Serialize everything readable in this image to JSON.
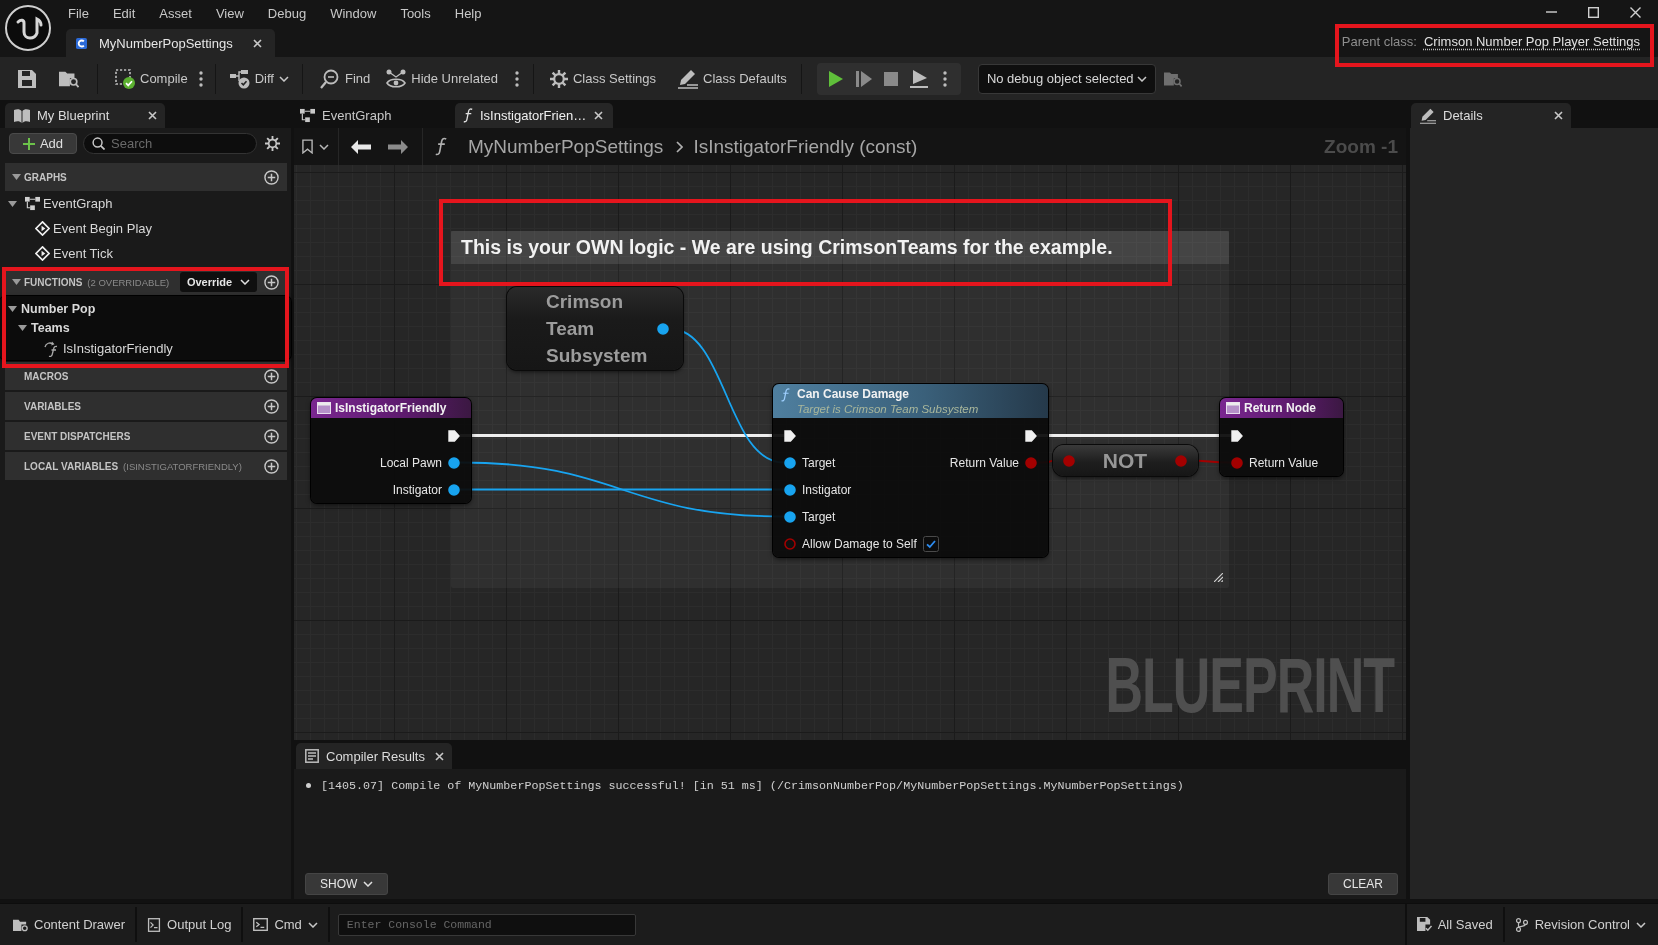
{
  "menu": [
    "File",
    "Edit",
    "Asset",
    "View",
    "Debug",
    "Window",
    "Tools",
    "Help"
  ],
  "document_tab": "MyNumberPopSettings",
  "parent_class": {
    "label": "Parent class:",
    "value": "Crimson Number Pop Player Settings",
    "highlighted": true
  },
  "toolbar": {
    "compile": "Compile",
    "diff": "Diff",
    "find": "Find",
    "hide_unrelated": "Hide Unrelated",
    "class_settings": "Class Settings",
    "class_defaults": "Class Defaults",
    "debug_object": "No debug object selected"
  },
  "my_blueprint": {
    "tab": "My Blueprint",
    "add_button": "Add",
    "search": {
      "placeholder": "Search"
    },
    "sections": [
      {
        "title": "GRAPHS",
        "highlighted": false,
        "expanded": true,
        "items": [
          {
            "kind": "graph",
            "label": "EventGraph",
            "expanded": true,
            "children": [
              {
                "kind": "event",
                "label": "Event Begin Play"
              },
              {
                "kind": "event",
                "label": "Event Tick"
              }
            ]
          }
        ]
      },
      {
        "title": "FUNCTIONS",
        "note": "(2 OVERRIDABLE)",
        "dropdown": "Override",
        "highlighted": true,
        "expanded": true,
        "items": [
          {
            "kind": "category",
            "label": "Number Pop",
            "expanded": true,
            "children": [
              {
                "kind": "category",
                "label": "Teams",
                "expanded": true,
                "children": [
                  {
                    "kind": "function",
                    "label": "IsInstigatorFriendly"
                  }
                ]
              }
            ]
          }
        ]
      },
      {
        "title": "MACROS",
        "highlighted": false
      },
      {
        "title": "VARIABLES",
        "highlighted": false
      },
      {
        "title": "EVENT DISPATCHERS",
        "highlighted": false
      },
      {
        "title": "LOCAL VARIABLES",
        "note": "(ISINSTIGATORFRIENDLY)",
        "highlighted": false
      }
    ]
  },
  "graph_tabs": [
    {
      "kind": "graph",
      "label": "EventGraph",
      "selected": false
    },
    {
      "kind": "function",
      "label": "IsInstigatorFrien…",
      "selected": true
    }
  ],
  "breadcrumb": {
    "path": [
      "MyNumberPopSettings",
      "IsInstigatorFriendly (const)"
    ],
    "zoom": "Zoom -1"
  },
  "graph": {
    "comment": {
      "text": "This is your OWN logic - We are using CrimsonTeams for the example.",
      "highlighted": true
    },
    "nodes": [
      {
        "kind": "getter",
        "title": "Crimson Team Subsystem",
        "outputs": [
          {
            "kind": "object",
            "connected": true
          }
        ]
      },
      {
        "kind": "entry",
        "title": "IsInstigatorFriendly",
        "outputs": [
          {
            "kind": "exec",
            "connected": true
          },
          {
            "kind": "object",
            "label": "Local Pawn",
            "connected": true
          },
          {
            "kind": "object",
            "label": "Instigator",
            "connected": true
          }
        ]
      },
      {
        "kind": "call",
        "title": "Can Cause Damage",
        "subtitle": "Target is Crimson Team Subsystem",
        "inputs": [
          {
            "kind": "exec",
            "connected": true
          },
          {
            "kind": "object",
            "label": "Target",
            "connected": true
          },
          {
            "kind": "object",
            "label": "Instigator",
            "connected": true
          },
          {
            "kind": "object",
            "label": "Target",
            "connected": true
          },
          {
            "kind": "bool",
            "label": "Allow Damage to Self",
            "connected": false,
            "checked": true
          }
        ],
        "outputs": [
          {
            "kind": "exec",
            "connected": true
          },
          {
            "kind": "bool",
            "label": "Return Value",
            "connected": true
          }
        ]
      },
      {
        "kind": "operator",
        "title": "NOT",
        "inputs": [
          {
            "kind": "bool",
            "connected": true
          }
        ],
        "outputs": [
          {
            "kind": "bool",
            "connected": true
          }
        ]
      },
      {
        "kind": "result",
        "title": "Return Node",
        "inputs": [
          {
            "kind": "exec",
            "connected": true
          },
          {
            "kind": "bool",
            "label": "Return Value",
            "connected": true
          }
        ]
      }
    ],
    "watermark": "BLUEPRINT"
  },
  "compiler_results": {
    "tab": "Compiler Results",
    "messages": [
      "[1405.07] Compile of MyNumberPopSettings successful! [in 51 ms] (/CrimsonNumberPop/MyNumberPopSettings.MyNumberPopSettings)"
    ],
    "show_button": "SHOW",
    "clear_button": "CLEAR"
  },
  "details": {
    "tab": "Details"
  },
  "status_bar": {
    "content_drawer": "Content Drawer",
    "output_log": "Output Log",
    "cmd": "Cmd",
    "console": {
      "placeholder": "Enter Console Command"
    },
    "save_state": "All Saved",
    "revision_control": "Revision Control"
  }
}
